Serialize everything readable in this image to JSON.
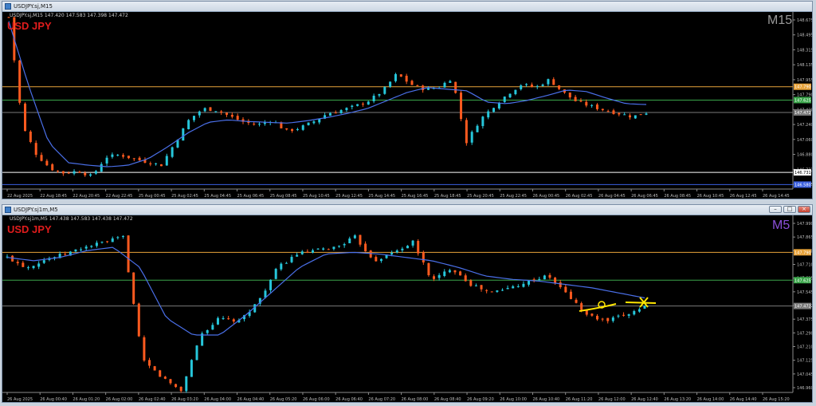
{
  "top": {
    "window_title": "USDJPY.sj,M15",
    "info_line": "USDJPY.sj,M15  147.420 147.583 147.398 147.472",
    "symbol_label": "USD JPY",
    "timeframe_label": "M15",
    "timeframe_color": "#9a9a9a",
    "y_ticks": [
      "148.675",
      "148.495",
      "148.315",
      "148.135",
      "147.955",
      "147.790",
      "147.420",
      "147.240",
      "147.060",
      "146.880",
      "146.731",
      "146.525"
    ],
    "hlines": [
      {
        "label": "147.790",
        "color": "#e8a33a"
      },
      {
        "label": "147.625",
        "color": "#3aa64a"
      },
      {
        "label": "147.472",
        "color": "#7a7a7a"
      },
      {
        "label": "146.731",
        "color": "#ffffff"
      },
      {
        "label": "146.580",
        "color": "#3a5fe0"
      }
    ],
    "x_ticks": [
      "22 Aug 2025",
      "22 Aug 18:45",
      "22 Aug 20:45",
      "22 Aug 22:45",
      "25 Aug 00:45",
      "25 Aug 02:45",
      "25 Aug 04:45",
      "25 Aug 06:45",
      "25 Aug 08:45",
      "25 Aug 10:45",
      "25 Aug 12:45",
      "25 Aug 14:45",
      "25 Aug 16:45",
      "25 Aug 18:45",
      "25 Aug 20:45",
      "25 Aug 22:45",
      "26 Aug 00:45",
      "26 Aug 02:45",
      "26 Aug 04:45",
      "26 Aug 06:45",
      "26 Aug 08:45",
      "26 Aug 10:45",
      "26 Aug 12:45",
      "26 Aug 14:45"
    ]
  },
  "bottom": {
    "window_title": "USDJPY.sj1m,M5",
    "info_line": "USDJPY.sj1m,M5  147.438 147.583 147.438 147.472",
    "symbol_label": "USD JPY",
    "timeframe_label": "M5",
    "timeframe_color": "#8a4fd8",
    "y_ticks": [
      "147.990",
      "147.865",
      "147.790",
      "147.710",
      "147.625",
      "147.545",
      "147.472",
      "147.375",
      "147.290",
      "147.210",
      "147.125",
      "147.045",
      "146.960"
    ],
    "hlines": [
      {
        "label": "147.790",
        "color": "#e8a33a"
      },
      {
        "label": "147.625",
        "color": "#3aa64a"
      },
      {
        "label": "147.472",
        "color": "#7a7a7a"
      }
    ],
    "x_ticks": [
      "26 Aug 2025",
      "26 Aug 00:40",
      "26 Aug 01:20",
      "26 Aug 02:00",
      "26 Aug 02:40",
      "26 Aug 03:20",
      "26 Aug 04:00",
      "26 Aug 04:40",
      "26 Aug 05:20",
      "26 Aug 06:00",
      "26 Aug 06:40",
      "26 Aug 07:20",
      "26 Aug 08:00",
      "26 Aug 08:40",
      "26 Aug 09:20",
      "26 Aug 10:00",
      "26 Aug 10:40",
      "26 Aug 11:20",
      "26 Aug 12:00",
      "26 Aug 12:40",
      "26 Aug 13:20",
      "26 Aug 14:00",
      "26 Aug 14:40",
      "26 Aug 15:20"
    ]
  },
  "colors": {
    "bull": "#26c6da",
    "bear": "#ff5a1f",
    "ma": "#4a6fe8",
    "annotation": "#ffe600"
  },
  "chart_data": [
    {
      "type": "candlestick",
      "title": "USDJPY.sj,M15",
      "ylim": [
        146.525,
        148.675
      ],
      "close_path": [
        148.65,
        147.3,
        146.95,
        146.78,
        146.72,
        146.75,
        146.68,
        146.92,
        146.95,
        146.9,
        146.86,
        146.82,
        147.1,
        147.38,
        147.52,
        147.5,
        147.42,
        147.35,
        147.32,
        147.38,
        147.24,
        147.28,
        147.36,
        147.46,
        147.5,
        147.55,
        147.62,
        147.74,
        147.95,
        147.82,
        147.76,
        147.78,
        147.9,
        147.1,
        147.38,
        147.55,
        147.7,
        147.82,
        147.78,
        147.88,
        147.72,
        147.6,
        147.55,
        147.5,
        147.46,
        147.42,
        147.47
      ],
      "ma_path": [
        148.6,
        147.8,
        147.1,
        146.85,
        146.82,
        146.8,
        146.82,
        146.9,
        147.05,
        147.22,
        147.35,
        147.38,
        147.36,
        147.35,
        147.34,
        147.37,
        147.41,
        147.46,
        147.52,
        147.62,
        147.72,
        147.78,
        147.76,
        147.74,
        147.6,
        147.58,
        147.62,
        147.68,
        147.75,
        147.73,
        147.65,
        147.58,
        147.57
      ]
    },
    {
      "type": "candlestick",
      "title": "USDJPY.sj1m,M5",
      "ylim": [
        146.96,
        147.99
      ],
      "close_path": [
        147.76,
        147.7,
        147.75,
        147.78,
        147.82,
        147.85,
        147.88,
        147.15,
        147.05,
        146.97,
        147.3,
        147.4,
        147.38,
        147.5,
        147.7,
        147.78,
        147.8,
        147.82,
        147.88,
        147.74,
        147.79,
        147.85,
        147.62,
        147.7,
        147.6,
        147.55,
        147.58,
        147.62,
        147.65,
        147.54,
        147.42,
        147.38,
        147.42,
        147.47
      ],
      "ma_path": [
        147.76,
        147.74,
        147.76,
        147.8,
        147.82,
        147.7,
        147.4,
        147.3,
        147.3,
        147.42,
        147.56,
        147.7,
        147.78,
        147.79,
        147.78,
        147.76,
        147.74,
        147.7,
        147.65,
        147.63,
        147.62,
        147.6,
        147.58,
        147.55,
        147.52
      ]
    }
  ]
}
